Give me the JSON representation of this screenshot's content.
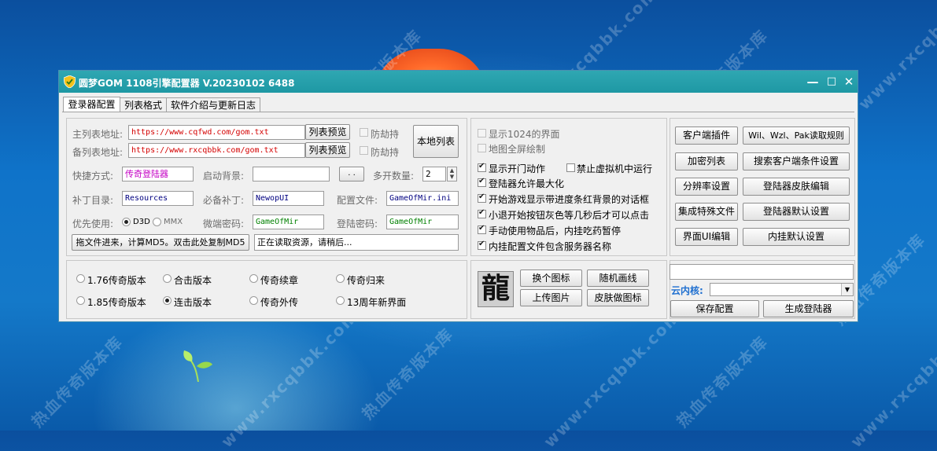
{
  "window": {
    "title": "圆梦GOM 1108引擎配置器 V.20230102 6488",
    "minimize": "—",
    "maximize": "□",
    "close": "✕"
  },
  "tabs": [
    "登录器配置",
    "列表格式",
    "软件介绍与更新日志"
  ],
  "form": {
    "main_list_label": "主列表地址:",
    "main_list_value": "https://www.cqfwd.com/gom.txt",
    "backup_list_label": "备列表地址:",
    "backup_list_value": "https://www.rxcqbbk.com/gom.txt",
    "preview_button": "列表预览",
    "anti_hijack": "防劫持",
    "local_list_button": "本地列表",
    "shortcut_label": "快捷方式:",
    "shortcut_value": "传奇登陆器",
    "bg_label": "启动背景:",
    "bg_value": "",
    "browse_button": ". .",
    "multi_open_label": "多开数量:",
    "multi_open_value": "2",
    "patch_dir_label": "补丁目录:",
    "patch_dir_value": "Resources",
    "required_patch_label": "必备补丁:",
    "required_patch_value": "NewopUI",
    "config_file_label": "配置文件:",
    "config_file_value": "GameOfMir.ini",
    "priority_label": "优先使用:",
    "priority_d3d": "D3D",
    "priority_mmx": "MMX",
    "micro_pwd_label": "微端密码:",
    "micro_pwd_value": "GameOfMir",
    "login_pwd_label": "登陆密码:",
    "login_pwd_value": "GameOfMir",
    "md5_button": "拖文件进来，计算MD5。双击此处复制MD5",
    "status_text": "正在读取资源，请稍后..."
  },
  "options": [
    {
      "label": "显示1024的界面",
      "checked": false,
      "disabled": true
    },
    {
      "label": "地图全屏绘制",
      "checked": false,
      "disabled": true
    },
    {
      "label": "显示开门动作",
      "checked": true,
      "disabled": false
    },
    {
      "label": "登陆器允许最大化",
      "checked": true,
      "disabled": false
    },
    {
      "label": "开始游戏显示带进度条红背景的对话框",
      "checked": true,
      "disabled": false
    },
    {
      "label": "小退开始按钮灰色等几秒后才可以点击",
      "checked": true,
      "disabled": false
    },
    {
      "label": "手动使用物品后，内挂吃药暂停",
      "checked": true,
      "disabled": false
    },
    {
      "label": "内挂配置文件包含服务器名称",
      "checked": true,
      "disabled": false
    }
  ],
  "vm_option": {
    "label": "禁止虚拟机中运行",
    "checked": false
  },
  "right_buttons_left": [
    "客户端插件",
    "加密列表",
    "分辨率设置",
    "集成特殊文件",
    "界面UI编辑"
  ],
  "right_buttons_right": [
    "Wil、Wzl、Pak读取规则",
    "搜索客户端条件设置",
    "登陆器皮肤编辑",
    "登陆器默认设置",
    "内挂默认设置"
  ],
  "versions": [
    {
      "label": "1.76传奇版本",
      "checked": false
    },
    {
      "label": "合击版本",
      "checked": false
    },
    {
      "label": "传奇续章",
      "checked": false
    },
    {
      "label": "传奇归来",
      "checked": false
    },
    {
      "label": "1.85传奇版本",
      "checked": false
    },
    {
      "label": "连击版本",
      "checked": true
    },
    {
      "label": "传奇外传",
      "checked": false
    },
    {
      "label": "13周年新界面",
      "checked": false
    }
  ],
  "icon_panel": {
    "glyph": "龍",
    "change_icon": "换个图标",
    "random_draw": "随机画线",
    "upload_image": "上传图片",
    "skin_icon": "皮肤做图标"
  },
  "bottom_right": {
    "cloud_core_label": "云内核:",
    "cloud_core_value": "",
    "save_button": "保存配置",
    "generate_button": "生成登陆器"
  },
  "watermarks": [
    "热血传奇版本库",
    "www.rxcqbbk.com"
  ],
  "colors": {
    "titlebar": "#1e98a4",
    "url_text": "#d40000",
    "shortcut_text": "#c400c4",
    "path_text": "#000080",
    "password_text": "#008000",
    "cloud_label": "#1e6fd0"
  }
}
